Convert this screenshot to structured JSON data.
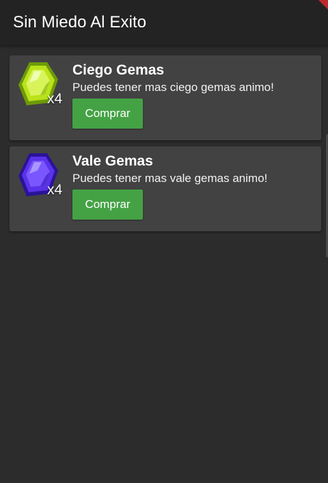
{
  "header": {
    "title": "Sin Miedo Al Exito"
  },
  "items": [
    {
      "icon": "green-gem-icon",
      "quantity": "x4",
      "title": "Ciego Gemas",
      "description": "Puedes tener mas ciego gemas animo!",
      "button_label": "Comprar",
      "gem_color": "#b9e21a"
    },
    {
      "icon": "purple-gem-icon",
      "quantity": "x4",
      "title": "Vale Gemas",
      "description": "Puedes tener mas vale gemas animo!",
      "button_label": "Comprar",
      "gem_color": "#5a32e8"
    }
  ],
  "colors": {
    "background": "#2c2c2c",
    "appbar": "#232323",
    "card": "#424242",
    "button": "#44a245"
  }
}
